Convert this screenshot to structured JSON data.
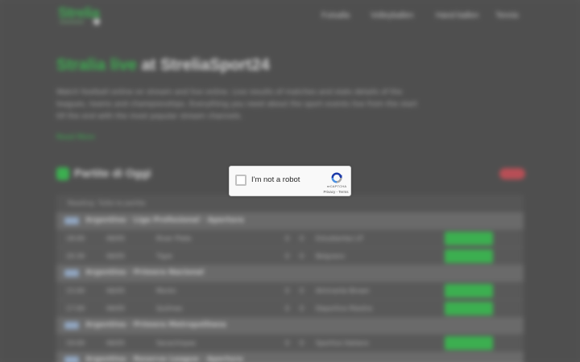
{
  "page": {
    "logo_text": "Strelia",
    "nav": [
      "Futsalla",
      "Volleyballen",
      "Hand ballen",
      "Tennis"
    ],
    "hero": {
      "title_brand": "Stralia live",
      "title_rest": "at StreliaSport24"
    },
    "description": "Watch football online on stream and live online. Live results of matches and stats details of the leagues, teams and championships. Everything you need about the sport events live from the start till the end with the most popular stream channels.",
    "read_more": "Read More",
    "section_title": "Partite di Oggi",
    "table_header": "Reading: Tutte le partite",
    "leagues": [
      {
        "name": "Argentina · Liga Profesional · Apertura",
        "matches": [
          {
            "time": "18:00",
            "date": "06/05",
            "home": "River Plate",
            "score_h": "0",
            "score_a": "0",
            "away": "Estudiantes LP"
          },
          {
            "time": "20:30",
            "date": "06/05",
            "home": "Tigre",
            "score_h": "0",
            "score_a": "0",
            "away": "Belgrano"
          }
        ]
      },
      {
        "name": "Argentina · Primera Nacional",
        "matches": [
          {
            "time": "15:00",
            "date": "06/05",
            "home": "Morón",
            "score_h": "0",
            "score_a": "0",
            "away": "Almirante Brown"
          },
          {
            "time": "17:00",
            "date": "06/05",
            "home": "Quilmes",
            "score_h": "0",
            "score_a": "0",
            "away": "Deportivo Riestra"
          }
        ]
      },
      {
        "name": "Argentina · Primera Metropolitana",
        "matches": [
          {
            "time": "19:00",
            "date": "06/05",
            "home": "Sacachispas",
            "score_h": "0",
            "score_a": "0",
            "away": "Sportivo Italiano"
          }
        ]
      },
      {
        "name": "Argentina · Reserve League · Apertura",
        "matches": []
      }
    ]
  },
  "captcha": {
    "label": "I'm not a robot",
    "brand": "reCAPTCHA",
    "privacy": "Privacy",
    "separator": " - ",
    "terms": "Terms"
  },
  "colors": {
    "accent": "#3fbf55",
    "live_badge": "#c9545c",
    "backdrop": "#545454"
  }
}
